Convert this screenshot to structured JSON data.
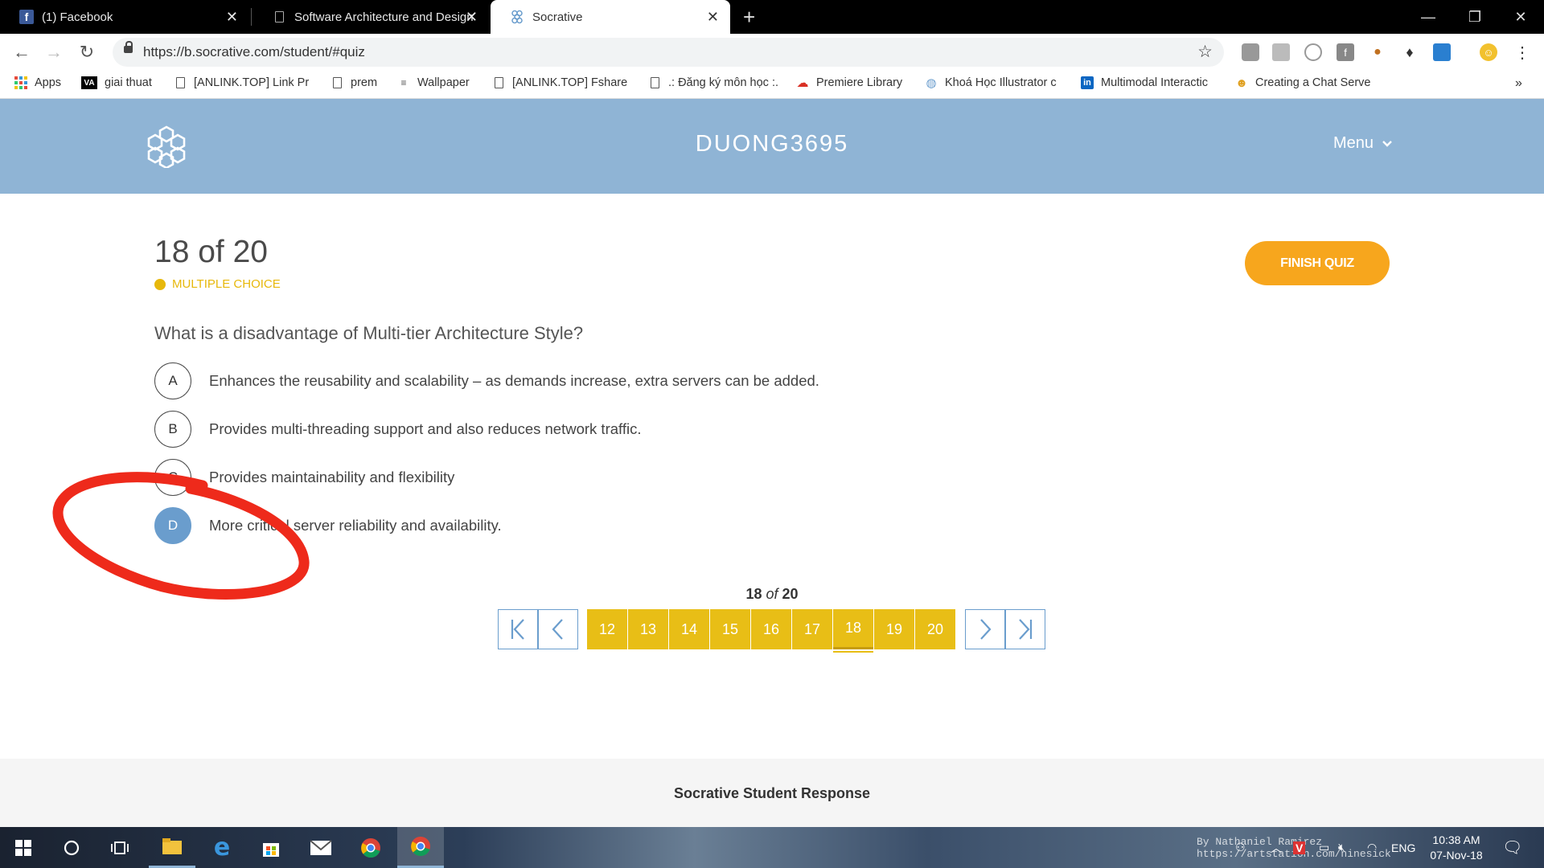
{
  "browser": {
    "tabs": [
      {
        "title": "(1) Facebook",
        "active": false
      },
      {
        "title": "Software Architecture and Design",
        "active": false
      },
      {
        "title": "Socrative",
        "active": true
      }
    ],
    "url": "https://b.socrative.com/student/#quiz",
    "bookmarks": [
      "Apps",
      "giai thuat",
      "[ANLINK.TOP] Link Pr",
      "prem",
      "Wallpaper",
      "[ANLINK.TOP] Fshare",
      ".: Đăng ký môn học :.",
      "Premiere Library",
      "Khoá Học Illustrator c",
      "Multimodal Interactic",
      "Creating a Chat Serve"
    ],
    "more_bookmarks": "»"
  },
  "header": {
    "username": "DUONG3695",
    "menu_label": "Menu"
  },
  "quiz": {
    "progress": "18 of 20",
    "question_type": "MULTIPLE CHOICE",
    "finish_label": "FINISH QUIZ",
    "question": "What is a disadvantage of Multi-tier Architecture Style?",
    "answers": [
      {
        "letter": "A",
        "text": "Enhances the reusability and scalability – as demands increase, extra servers can be added."
      },
      {
        "letter": "B",
        "text": "Provides multi-threading support and also reduces network traffic."
      },
      {
        "letter": "C",
        "text": "Provides maintainability and flexibility"
      },
      {
        "letter": "D",
        "text": "More critical server reliability and availability."
      }
    ],
    "selected": "D"
  },
  "pagination": {
    "current": "18",
    "of_word": "of",
    "total": "20",
    "pages": [
      "12",
      "13",
      "14",
      "15",
      "16",
      "17",
      "18",
      "19",
      "20"
    ]
  },
  "footer": {
    "text": "Socrative Student Response"
  },
  "taskbar": {
    "language": "ENG",
    "time": "10:38 AM",
    "date": "07-Nov-18",
    "watermark": "By Nathaniel Ramirez https://artstation.com/ninesick"
  },
  "colors": {
    "header_blue": "#8fb4d5",
    "accent_yellow": "#e8be16",
    "finish_orange": "#f7a61d",
    "selected_blue": "#6a9dcd",
    "annotation_red": "#ee2a1b"
  }
}
